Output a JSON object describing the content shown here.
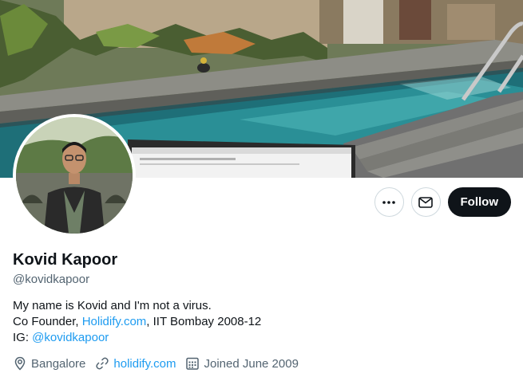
{
  "profile": {
    "name": "Kovid Kapoor",
    "handle": "@kovidkapoor",
    "bio": {
      "line1": "My name is Kovid and I'm not a virus.",
      "line2_prefix": "Co Founder, ",
      "line2_link": "Holidify.com",
      "line2_suffix": ", IIT Bombay 2008-12",
      "line3_prefix": "IG: ",
      "line3_link": "@kovidkapoor"
    },
    "location": "Bangalore",
    "website": "holidify.com",
    "joined": "Joined June 2009"
  },
  "actions": {
    "more_icon": "more-icon",
    "message_icon": "envelope-icon",
    "follow_label": "Follow"
  },
  "colors": {
    "link": "#1d9bf0",
    "follow_bg": "#0f1419",
    "secondary_text": "#536471",
    "border": "#cfd9de"
  }
}
